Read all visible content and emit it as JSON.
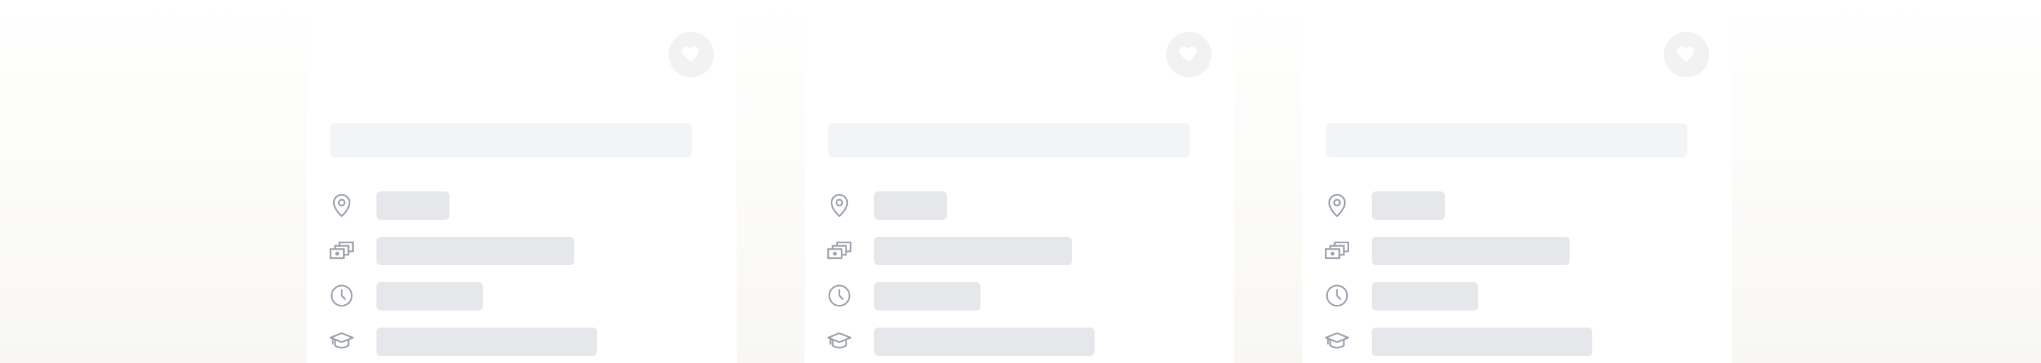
{
  "colors": {
    "background_top": "#ffffff",
    "background_bottom": "#f8f7f3",
    "card": "#ffffff",
    "skeleton_title": "#f3f4f6",
    "skeleton_row": "#e5e7eb",
    "icon_stroke": "#9ca3af",
    "favorite_circle": "#f2f2f2"
  },
  "cards": [
    {
      "state": "loading",
      "favorite_icon": "heart-icon",
      "rows": [
        {
          "icon": "location-pin-icon"
        },
        {
          "icon": "money-icon"
        },
        {
          "icon": "clock-icon"
        },
        {
          "icon": "graduation-cap-icon"
        }
      ]
    },
    {
      "state": "loading",
      "favorite_icon": "heart-icon",
      "rows": [
        {
          "icon": "location-pin-icon"
        },
        {
          "icon": "money-icon"
        },
        {
          "icon": "clock-icon"
        },
        {
          "icon": "graduation-cap-icon"
        }
      ]
    },
    {
      "state": "loading",
      "favorite_icon": "heart-icon",
      "rows": [
        {
          "icon": "location-pin-icon"
        },
        {
          "icon": "money-icon"
        },
        {
          "icon": "clock-icon"
        },
        {
          "icon": "graduation-cap-icon"
        }
      ]
    }
  ]
}
